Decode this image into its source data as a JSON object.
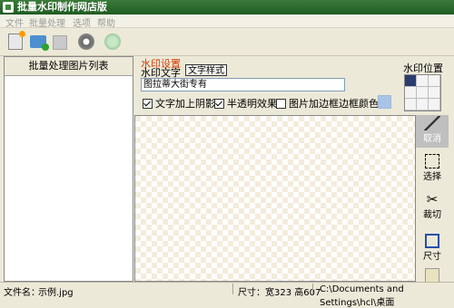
{
  "window": {
    "title": "批量水印制作网店版"
  },
  "menu": [
    "文件",
    "批量处理",
    "选项",
    "帮助"
  ],
  "toolbar": {
    "icons": [
      "new-icon",
      "open-icon",
      "save-icon",
      "settings-icon",
      "run-icon"
    ]
  },
  "left_panel": {
    "header": "批量处理图片列表"
  },
  "watermark": {
    "section_title": "水印设置",
    "text_label": "水印文字",
    "style_button": "文字样式",
    "text_value": "图拉蒂大街专有",
    "position_label": "水印位置",
    "position_selected": "top-left",
    "options": [
      {
        "label": "文字加上阴影",
        "checked": true
      },
      {
        "label": "半透明效果",
        "checked": true
      },
      {
        "label": "图片加边框",
        "checked": false
      }
    ],
    "border_color_label": "边框颜色",
    "border_color": "#a9c4e6"
  },
  "right_tools": {
    "cancel": "取消",
    "select": "选择",
    "crop": "裁切",
    "size": "尺寸"
  },
  "status": {
    "filename_label": "文件名：",
    "filename": "示例.jpg",
    "size_label": "尺寸：宽323 高607",
    "path": "C:\\Documents and Settings\\hcl\\桌面"
  }
}
